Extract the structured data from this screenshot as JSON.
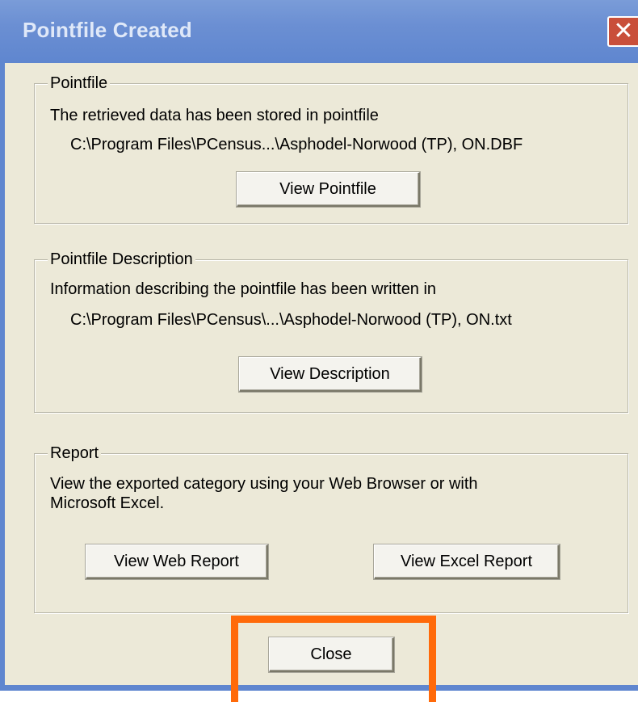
{
  "window": {
    "title": "Pointfile Created",
    "close_glyph": "✕"
  },
  "pointfile": {
    "legend": "Pointfile",
    "line1": "The retrieved data has been stored in pointfile",
    "path": "C:\\Program Files\\PCensus...\\Asphodel-Norwood (TP), ON.DBF",
    "button": "View Pointfile"
  },
  "description": {
    "legend": "Pointfile Description",
    "line1": "Information describing the pointfile has been written in",
    "path": "C:\\Program Files\\PCensus\\...\\Asphodel-Norwood (TP), ON.txt",
    "button": "View Description"
  },
  "report": {
    "legend": "Report",
    "line1": "View the exported category using your Web Browser or with",
    "line2": "Microsoft Excel.",
    "web_button": "View Web Report",
    "excel_button": "View Excel Report"
  },
  "footer": {
    "close_button": "Close"
  },
  "colors": {
    "highlight": "#ff6a0a",
    "titlebar": "#6b8fd3",
    "dialog_bg": "#ece9d8"
  }
}
